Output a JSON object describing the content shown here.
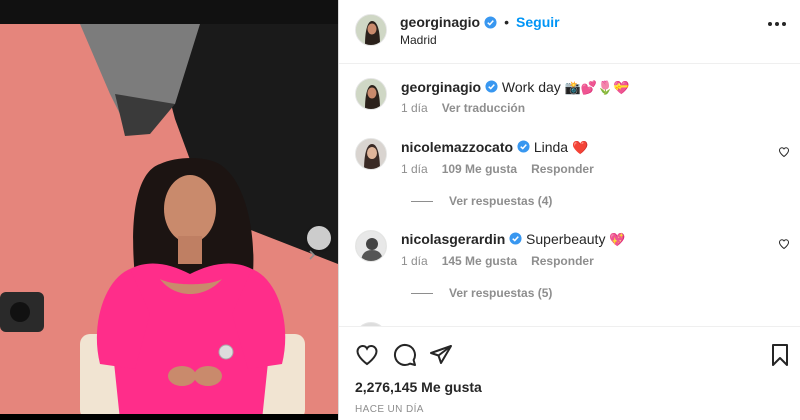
{
  "post": {
    "username": "georginagio",
    "follow_label": "Seguir",
    "separator": "•",
    "location": "Madrid",
    "caption": {
      "username": "georginagio",
      "text": "Work day",
      "emojis": "📸💕🌷💝",
      "time": "1 día",
      "translate_label": "Ver traducción"
    }
  },
  "comments": [
    {
      "username": "nicolemazzocato",
      "text": "Linda",
      "emoji": "❤️",
      "time": "1 día",
      "likes": "109 Me gusta",
      "reply_label": "Responder",
      "view_replies": "Ver respuestas (4)"
    },
    {
      "username": "nicolasgerardin",
      "text": "Superbeauty",
      "emoji": "💖",
      "time": "1 día",
      "likes": "145 Me gusta",
      "reply_label": "Responder",
      "view_replies": "Ver respuestas (5)"
    }
  ],
  "actions": {
    "like_count": "2,276,145 Me gusta",
    "timestamp": "HACE UN DÍA"
  },
  "icons": {
    "verified": "verified-badge-icon",
    "more": "more-options-icon",
    "heart": "heart-icon",
    "comment": "comment-icon",
    "share": "share-icon",
    "save": "bookmark-icon",
    "next": "chevron-right-icon"
  },
  "colors": {
    "accent": "#0095f6",
    "verified": "#3897f0",
    "text": "#262626",
    "muted": "#8e8e8e",
    "photo_background": "#e78b80",
    "dress": "#ff2d8a"
  }
}
